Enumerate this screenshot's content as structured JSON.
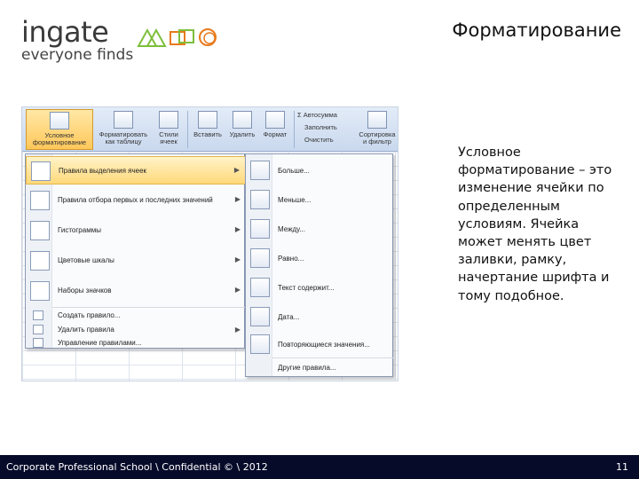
{
  "logo": {
    "word": "ingate",
    "tagline": "everyone finds"
  },
  "slide": {
    "title": "Форматирование",
    "body": "Условное форматирование – это изменение ячейки по определенным условиям. Ячейка может менять цвет заливки, рамку, начертание шрифта и тому подобное.",
    "footer": "Corporate Professional School \\ Confidential © \\ 2012",
    "page": "11"
  },
  "ribbon": {
    "cond_format": "Условное форматирование",
    "format_table": "Форматировать как таблицу",
    "styles": "Стили ячеек",
    "insert": "Вставить",
    "delete": "Удалить",
    "format": "Формат",
    "autosum": "Σ Автосумма",
    "fill": "Заполнить",
    "clear": "Очистить",
    "sort": "Сортировка и фильтр"
  },
  "menu": {
    "items": [
      {
        "label": "Правила выделения ячеек"
      },
      {
        "label": "Правила отбора первых и последних значений"
      },
      {
        "label": "Гистограммы"
      },
      {
        "label": "Цветовые шкалы"
      },
      {
        "label": "Наборы значков"
      }
    ],
    "small": [
      {
        "label": "Создать правило..."
      },
      {
        "label": "Удалить правила"
      },
      {
        "label": "Управление правилами..."
      }
    ]
  },
  "submenu": {
    "items": [
      {
        "label": "Больше..."
      },
      {
        "label": "Меньше..."
      },
      {
        "label": "Между..."
      },
      {
        "label": "Равно..."
      },
      {
        "label": "Текст содержит..."
      },
      {
        "label": "Дата..."
      },
      {
        "label": "Повторяющиеся значения..."
      }
    ],
    "other": "Другие правила..."
  },
  "colors": {
    "footer_bg": "#070b2a",
    "highlight": "#ffd97a",
    "logo_green": "#7dbf3c",
    "logo_orange": "#e77a1c"
  }
}
